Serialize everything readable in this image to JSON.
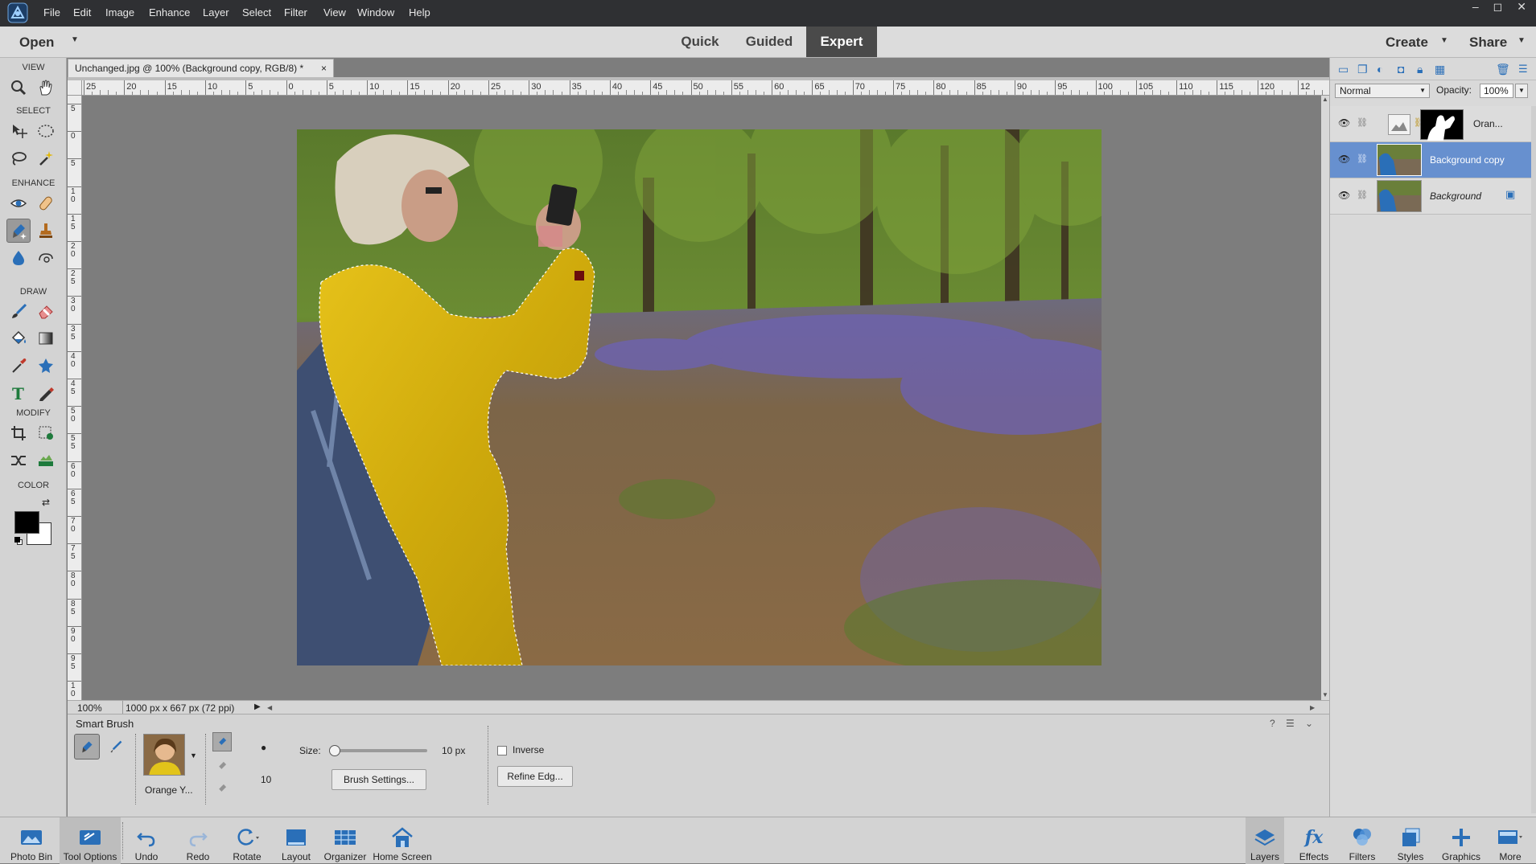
{
  "menu": [
    "File",
    "Edit",
    "Image",
    "Enhance",
    "Layer",
    "Select",
    "Filter",
    "View",
    "Window",
    "Help"
  ],
  "window_controls": [
    "–",
    "◻",
    "✕"
  ],
  "modebar": {
    "open_label": "Open",
    "tabs": [
      "Quick",
      "Guided",
      "Expert"
    ],
    "active_tab": "Expert",
    "create_label": "Create",
    "share_label": "Share"
  },
  "toolbox": {
    "sections": [
      "VIEW",
      "SELECT",
      "ENHANCE",
      "DRAW",
      "MODIFY",
      "COLOR"
    ],
    "selected_tool": "smart-brush-tool",
    "foreground_color": "#000000",
    "background_color": "#ffffff"
  },
  "document": {
    "tab_title": "Unchanged.jpg @ 100% (Background copy, RGB/8) *",
    "close": "×",
    "zoom": "100%",
    "info": "1000 px x 667 px (72 ppi)"
  },
  "ruler_h": [
    "25",
    "20",
    "15",
    "10",
    "5",
    "0",
    "5",
    "10",
    "15",
    "20",
    "25",
    "30",
    "35",
    "40",
    "45",
    "50",
    "55",
    "60",
    "65",
    "70",
    "75",
    "80",
    "85",
    "90",
    "95",
    "100",
    "105",
    "110",
    "115",
    "120",
    "12"
  ],
  "ruler_v": [
    "5",
    "0",
    "5",
    "1\n0",
    "1\n5",
    "2\n0",
    "2\n5",
    "3\n0",
    "3\n5",
    "4\n0",
    "4\n5",
    "5\n0",
    "5\n5",
    "6\n0",
    "6\n5",
    "7\n0",
    "7\n5",
    "8\n0",
    "8\n5",
    "9\n0",
    "9\n5",
    "1\n0"
  ],
  "tool_options": {
    "title": "Smart Brush",
    "preset_label": "Orange Y...",
    "brush_size_value": "10",
    "size_label": "Size:",
    "size_value": "10 px",
    "size_fraction": 0.02,
    "brush_settings_label": "Brush Settings...",
    "inverse_label": "Inverse",
    "inverse_checked": false,
    "refine_edge_label": "Refine Edg..."
  },
  "layers_panel": {
    "blend_mode": "Normal",
    "opacity_label": "Opacity:",
    "opacity_value": "100%",
    "layers": [
      {
        "name": "Oran...",
        "selected": false,
        "italic": false
      },
      {
        "name": "Background copy",
        "selected": true,
        "italic": false
      },
      {
        "name": "Background",
        "selected": false,
        "italic": true
      }
    ]
  },
  "bottom_bar": {
    "left": [
      "Photo Bin",
      "Tool Options",
      "Undo",
      "Redo",
      "Rotate",
      "Layout",
      "Organizer",
      "Home Screen"
    ],
    "right": [
      "Layers",
      "Effects",
      "Filters",
      "Styles",
      "Graphics",
      "More"
    ]
  },
  "colors": {
    "accent_selected_layer": "#6790cf",
    "jacket_yellow": "#d2b10e",
    "titlebar": "#2f3033"
  }
}
